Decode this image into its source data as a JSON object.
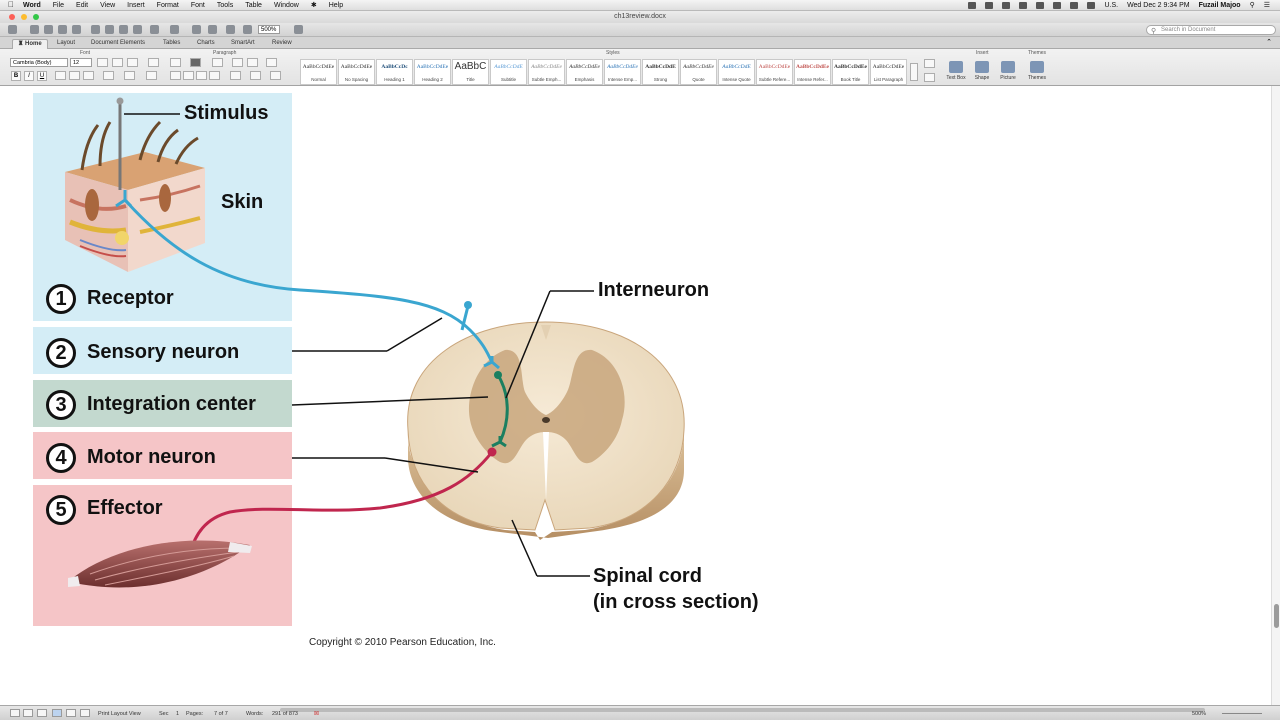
{
  "menubar": {
    "app": "Word",
    "items": [
      "File",
      "Edit",
      "View",
      "Insert",
      "Format",
      "Font",
      "Tools",
      "Table",
      "Window",
      "Help"
    ],
    "clock": "Wed Dec 2  9:34 PM",
    "user": "Fuzail Majoo",
    "input_source": "U.S."
  },
  "window": {
    "title": "ch13review.docx"
  },
  "toolbar": {
    "zoom": "500%",
    "search_placeholder": "Search in Document"
  },
  "ribbon": {
    "tabs": [
      "Home",
      "Layout",
      "Document Elements",
      "Tables",
      "Charts",
      "SmartArt",
      "Review"
    ],
    "active_tab": "Home",
    "groups": {
      "font": "Font",
      "paragraph": "Paragraph",
      "styles": "Styles",
      "insert": "Insert",
      "themes": "Themes"
    },
    "font_name": "Cambria (Body)",
    "font_size": "12",
    "format_buttons": [
      "B",
      "I",
      "U"
    ],
    "styles": [
      {
        "sample": "AaBbCcDdEe",
        "name": "Normal"
      },
      {
        "sample": "AaBbCcDdEe",
        "name": "No Spacing"
      },
      {
        "sample": "AaBbCcDc",
        "name": "Heading 1"
      },
      {
        "sample": "AaBbCcDdEe",
        "name": "Heading 2"
      },
      {
        "sample": "AaBbC",
        "name": "Title"
      },
      {
        "sample": "AaBbCcDdE",
        "name": "Subtitle"
      },
      {
        "sample": "AaBbCcDdEe",
        "name": "Subtle Emph..."
      },
      {
        "sample": "AaBbCcDdEe",
        "name": "Emphasis"
      },
      {
        "sample": "AaBbCcDdEe",
        "name": "Intense Emp..."
      },
      {
        "sample": "AaBbCcDdE",
        "name": "Strong"
      },
      {
        "sample": "AaBbCcDdEe",
        "name": "Quote"
      },
      {
        "sample": "AaBbCcDdE",
        "name": "Intense Quote"
      },
      {
        "sample": "AaBbCcDdEe",
        "name": "Subtle Refere..."
      },
      {
        "sample": "AaBbCcDdEe",
        "name": "Intense Refer..."
      },
      {
        "sample": "AaBbCcDdEe",
        "name": "Book Title"
      },
      {
        "sample": "AaBbCcDdEe",
        "name": "List Paragraph"
      }
    ],
    "insert_buttons": [
      "Text Box",
      "Shape",
      "Picture"
    ],
    "themes_button": "Themes"
  },
  "figure": {
    "stimulus": "Stimulus",
    "skin": "Skin",
    "steps": [
      {
        "num": "1",
        "label": "Receptor"
      },
      {
        "num": "2",
        "label": "Sensory neuron"
      },
      {
        "num": "3",
        "label": "Integration center"
      },
      {
        "num": "4",
        "label": "Motor neuron"
      },
      {
        "num": "5",
        "label": "Effector"
      }
    ],
    "interneuron": "Interneuron",
    "spinal_cord_line1": "Spinal cord",
    "spinal_cord_line2": "(in cross section)",
    "copyright": "Copyright © 2010 Pearson Education, Inc.",
    "colors": {
      "receptor_panel": "#d4edf6",
      "integration_panel": "#c3d9cf",
      "motor_panel": "#f5c5c7",
      "sensory_neuron": "#3aa6d0",
      "interneuron": "#1b7f60",
      "motor_neuron": "#c0264e"
    }
  },
  "statusbar": {
    "view": "Print Layout View",
    "sec_label": "Sec",
    "sec": "1",
    "pages_label": "Pages:",
    "pages": "7 of 7",
    "words_label": "Words:",
    "words": "291 of 873",
    "zoom": "500%"
  }
}
